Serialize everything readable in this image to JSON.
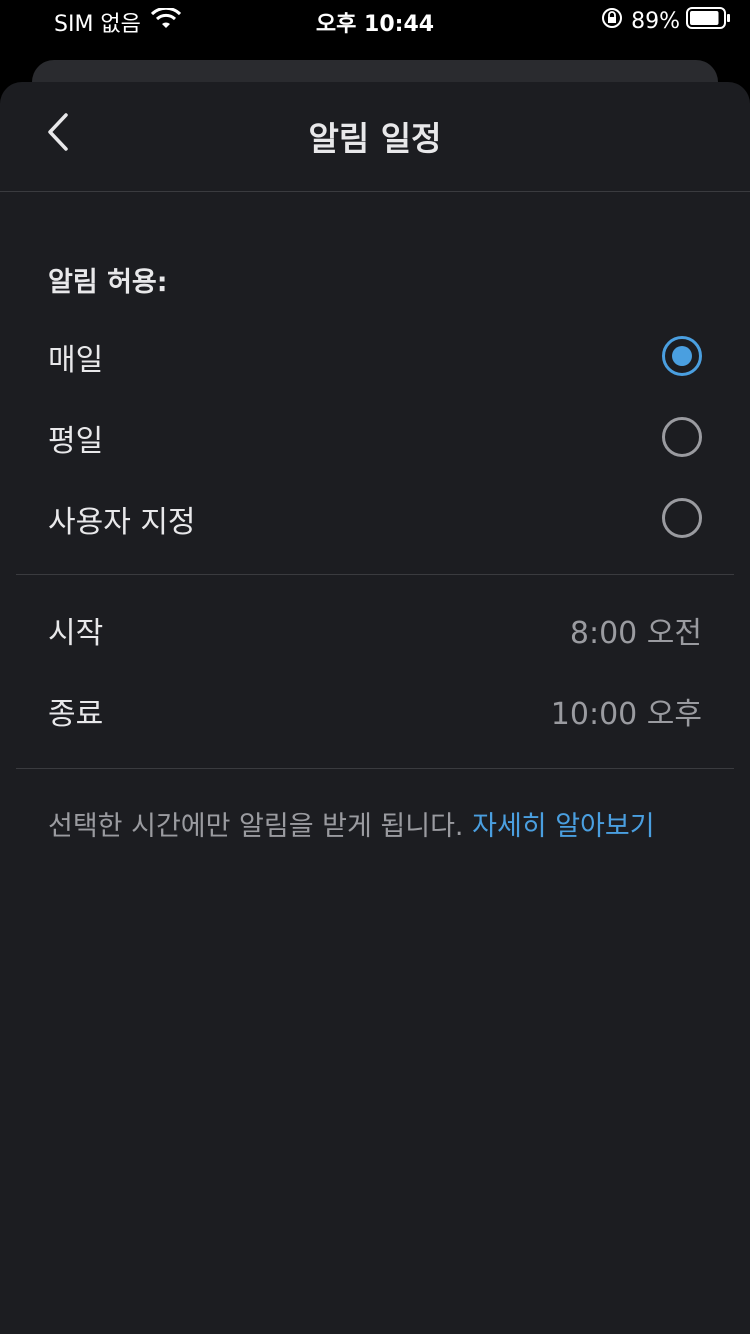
{
  "status_bar": {
    "carrier": "SIM 없음",
    "time": "오후 10:44",
    "battery_percent": "89%",
    "battery_level": 0.89
  },
  "nav": {
    "title": "알림 일정",
    "back_icon": "chevron-left-icon"
  },
  "section_label": "알림 허용:",
  "options": [
    {
      "label": "매일",
      "selected": true
    },
    {
      "label": "평일",
      "selected": false
    },
    {
      "label": "사용자 지정",
      "selected": false
    }
  ],
  "times": {
    "start": {
      "label": "시작",
      "value": "8:00 오전"
    },
    "end": {
      "label": "종료",
      "value": "10:00 오후"
    }
  },
  "footer": {
    "text": "선택한 시간에만 알림을 받게 됩니다.",
    "link": "자세히 알아보기"
  },
  "colors": {
    "background": "#1c1d21",
    "accent": "#4a9fe0",
    "text_primary": "#e8e8ea",
    "text_secondary": "#9a9ba0"
  }
}
